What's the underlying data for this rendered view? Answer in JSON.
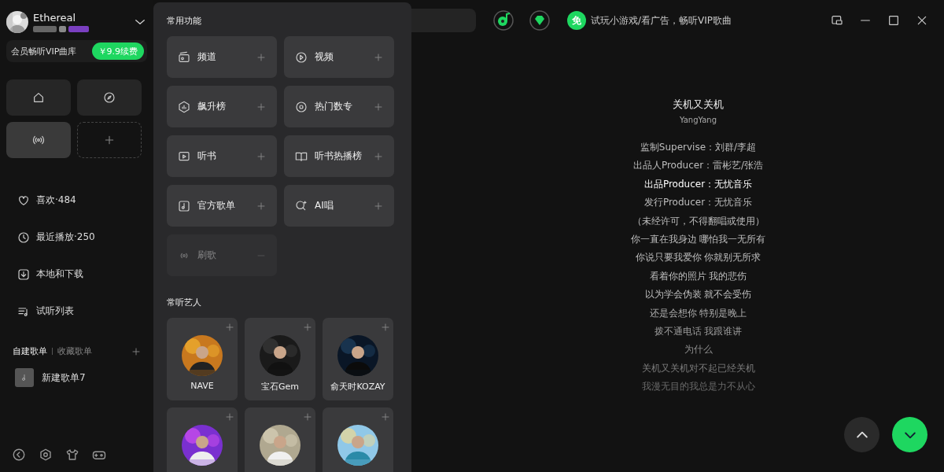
{
  "user": {
    "name": "Ethereal"
  },
  "vip_banner": {
    "text": "会员畅听VIP曲库",
    "button": "￥9.9续费"
  },
  "quick_tiles": [
    {
      "kind": "shortcut",
      "selected": false
    },
    {
      "kind": "shortcut",
      "selected": false
    },
    {
      "kind": "shortcut",
      "selected": true
    },
    {
      "kind": "add"
    }
  ],
  "sidebar": {
    "items": [
      {
        "label": "喜欢·484"
      },
      {
        "label": "最近播放·250"
      },
      {
        "label": "本地和下载"
      },
      {
        "label": "试听列表"
      }
    ]
  },
  "playlist_tabs": [
    {
      "label": "自建歌单",
      "selected": true
    },
    {
      "label": "收藏歌单",
      "selected": false
    }
  ],
  "playlists": [
    {
      "name": "新建歌单7"
    }
  ],
  "topbar": {
    "free_badge": "免",
    "promo": "试玩小游戏/看广告，畅听VIP歌曲"
  },
  "popup": {
    "sections": [
      {
        "title": "常用功能",
        "kind": "features",
        "items": [
          {
            "label": "频道",
            "disabled": false
          },
          {
            "label": "视频",
            "disabled": false
          },
          {
            "label": "飙升榜",
            "disabled": false
          },
          {
            "label": "热门数专",
            "disabled": false
          },
          {
            "label": "听书",
            "disabled": false
          },
          {
            "label": "听书热播榜",
            "disabled": false
          },
          {
            "label": "官方歌单",
            "disabled": false
          },
          {
            "label": "AI唱",
            "disabled": false
          },
          {
            "label": "刷歌",
            "disabled": true
          }
        ]
      },
      {
        "title": "常听艺人",
        "kind": "artists",
        "items": [
          {
            "kind": "named",
            "label": "NAVE"
          },
          {
            "kind": "named",
            "label": "宝石Gem"
          },
          {
            "kind": "named",
            "label": "俞天时KOZAY"
          },
          {
            "kind": "cut"
          },
          {
            "kind": "cut"
          },
          {
            "kind": "cut"
          }
        ]
      }
    ]
  },
  "lyrics": {
    "title": "关机又关机",
    "artist": "YangYang",
    "lines": [
      {
        "text": "监制Supervise：刘群/李超",
        "active": false
      },
      {
        "text": "出品人Producer：雷彬艺/张浩",
        "active": false
      },
      {
        "text": "出品Producer：无忧音乐",
        "active": true
      },
      {
        "text": "发行Producer：无忧音乐",
        "active": false
      },
      {
        "text": "（未经许可，不得翻唱或使用）",
        "active": false
      },
      {
        "text": "你一直在我身边 哪怕我一无所有",
        "active": false
      },
      {
        "text": "你说只要我爱你 你就别无所求",
        "active": false
      },
      {
        "text": "看着你的照片 我的悲伤",
        "active": false
      },
      {
        "text": "以为学会伪装 就不会受伤",
        "active": false
      },
      {
        "text": "还是会想你 特别是晚上",
        "active": false
      },
      {
        "text": "拨不通电话 我跟谁讲",
        "active": false
      },
      {
        "text": "为什么",
        "active": false
      },
      {
        "text": "关机又关机对不起已经关机",
        "active": false
      },
      {
        "text": "我漫无目的我总是力不从心",
        "active": false
      }
    ]
  }
}
